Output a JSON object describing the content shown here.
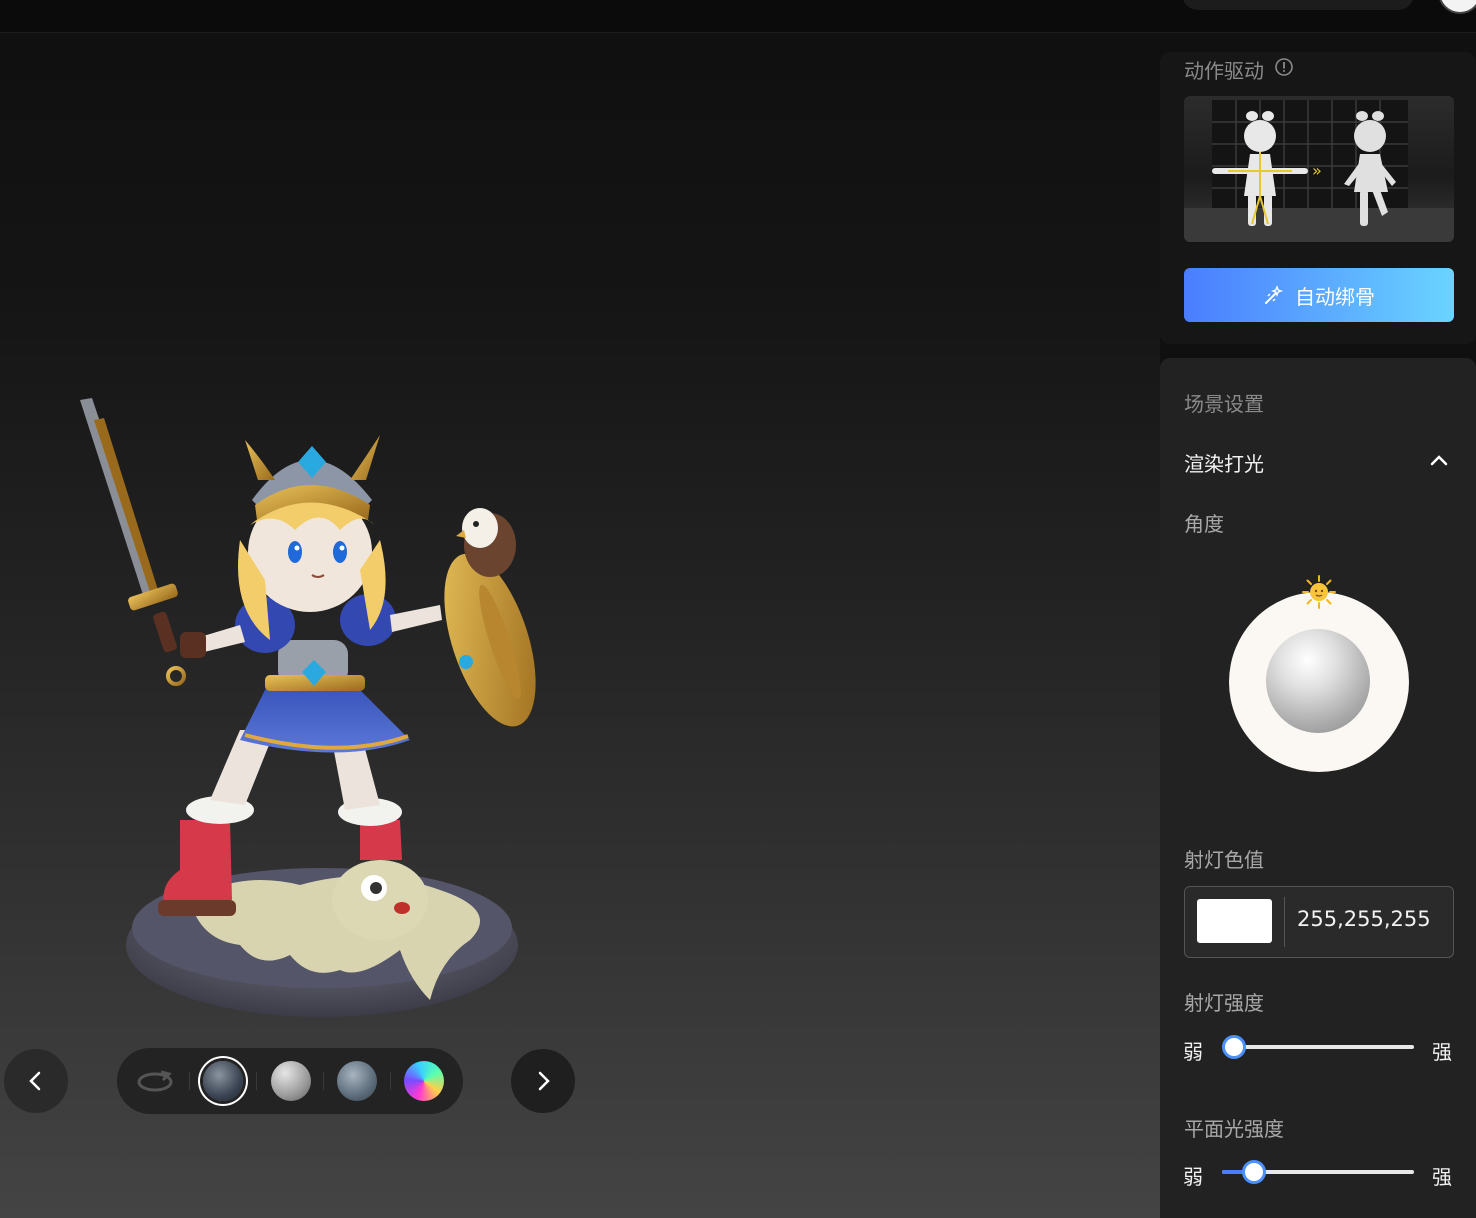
{
  "motion_section": {
    "title": "动作驱动",
    "info_icon": "info-circle-icon",
    "auto_rig_button": "自动绑骨",
    "auto_rig_icon": "magic-wand-icon"
  },
  "scene_settings": {
    "title": "场景设置",
    "render_lighting": {
      "title": "渲染打光",
      "expanded": true,
      "angle_label": "角度",
      "spotlight_color_label": "射灯色值",
      "spotlight_color_value": "255,255,255",
      "spotlight_color_hex": "#ffffff",
      "spotlight_intensity_label": "射灯强度",
      "spotlight_intensity_fraction": 0.0,
      "plane_light_label": "平面光强度",
      "plane_light_fraction": 0.12,
      "weak_label": "弱",
      "strong_label": "强"
    }
  },
  "env_toolbar": {
    "items": [
      "rotate-icon",
      "hdri-studio",
      "matte-gray",
      "hdri-outdoor",
      "gradient-rainbow"
    ],
    "selected_index": 1
  },
  "colors": {
    "accent": "#4a7dff",
    "button_gradient_end": "#6ad4ff"
  }
}
